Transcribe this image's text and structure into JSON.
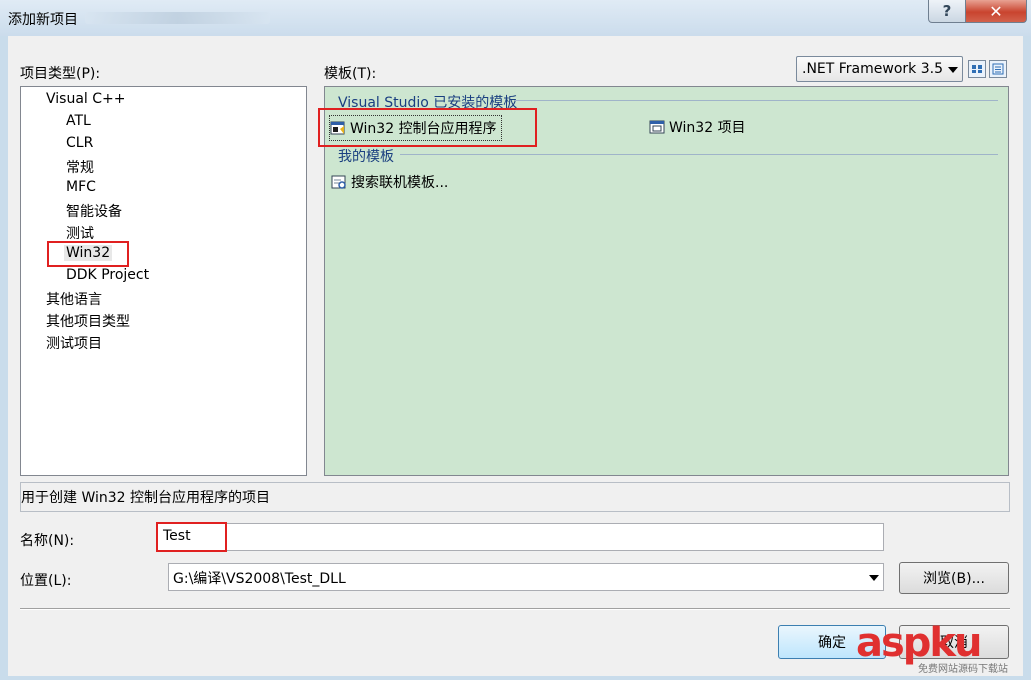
{
  "window": {
    "title": "添加新项目",
    "help_label": "?",
    "close_label": "✕"
  },
  "project_types": {
    "label": "项目类型(P):",
    "items": [
      {
        "label": "Visual C++",
        "level": 0
      },
      {
        "label": "ATL",
        "level": 1
      },
      {
        "label": "CLR",
        "level": 1
      },
      {
        "label": "常规",
        "level": 1
      },
      {
        "label": "MFC",
        "level": 1
      },
      {
        "label": "智能设备",
        "level": 1
      },
      {
        "label": "测试",
        "level": 1
      },
      {
        "label": "Win32",
        "level": 1,
        "selected": true
      },
      {
        "label": "DDK Project",
        "level": 1
      },
      {
        "label": "其他语言",
        "level": 0
      },
      {
        "label": "其他项目类型",
        "level": 0
      },
      {
        "label": "测试项目",
        "level": 0
      }
    ]
  },
  "templates": {
    "label": "模板(T):",
    "framework": ".NET Framework 3.5",
    "installed_group": "Visual Studio 已安装的模板",
    "installed_items": [
      {
        "label": "Win32 控制台应用程序",
        "icon": "console-app-icon",
        "selected": true
      },
      {
        "label": "Win32 项目",
        "icon": "win32-project-icon"
      }
    ],
    "my_group": "我的模板",
    "my_items": [
      {
        "label": "搜索联机模板...",
        "icon": "search-online-icon"
      }
    ]
  },
  "description": "用于创建 Win32 控制台应用程序的项目",
  "name_field": {
    "label": "名称(N):",
    "value": "Test"
  },
  "location_field": {
    "label": "位置(L):",
    "value": "G:\\编译\\VS2008\\Test_DLL"
  },
  "buttons": {
    "browse": "浏览(B)...",
    "ok": "确定",
    "cancel": "取消"
  },
  "watermark": {
    "text": "aspku",
    "sub": "免费网站源码下载站"
  },
  "colors": {
    "template_bg": "#cde6d0",
    "highlight_box": "#e02020",
    "group_title": "#1a3f80"
  }
}
